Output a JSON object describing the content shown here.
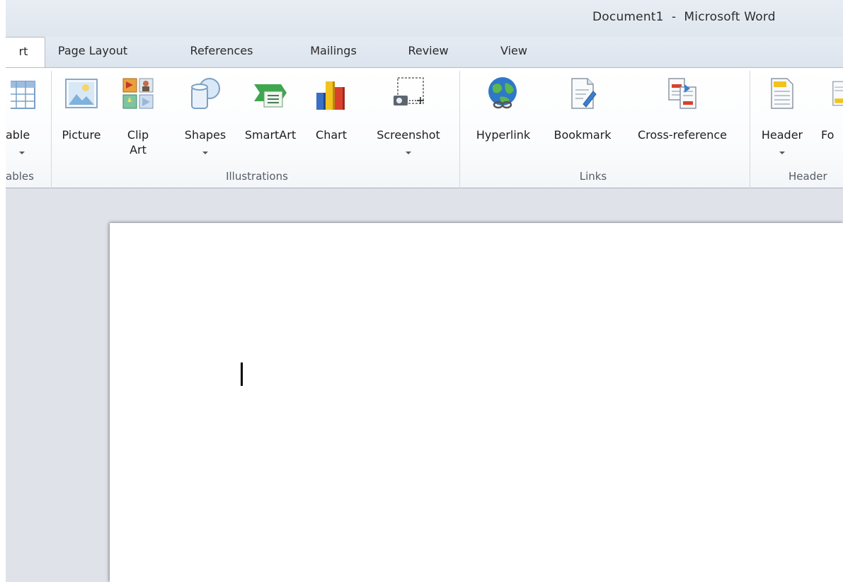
{
  "window": {
    "title": "Document1  -  Microsoft Word"
  },
  "tabs": [
    {
      "label": "rt",
      "active": true
    },
    {
      "label": "Page Layout"
    },
    {
      "label": "References"
    },
    {
      "label": "Mailings"
    },
    {
      "label": "Review"
    },
    {
      "label": "View"
    }
  ],
  "groups": {
    "tables": {
      "label": "ables",
      "buttons": {
        "table": "able"
      }
    },
    "illustrations": {
      "label": "Illustrations",
      "buttons": {
        "picture": "Picture",
        "clipart_line1": "Clip",
        "clipart_line2": "Art",
        "shapes": "Shapes",
        "smartart": "SmartArt",
        "chart": "Chart",
        "screenshot": "Screenshot"
      }
    },
    "links": {
      "label": "Links",
      "buttons": {
        "hyperlink": "Hyperlink",
        "bookmark": "Bookmark",
        "crossref": "Cross-reference"
      }
    },
    "header_footer": {
      "label": "Header",
      "buttons": {
        "header": "Header",
        "footer": "Fo"
      }
    }
  },
  "colors": {
    "ribbon_bg": "#ffffff",
    "workspace_bg": "#dfe3e9",
    "titlebar_bg": "#e3e9f1"
  }
}
